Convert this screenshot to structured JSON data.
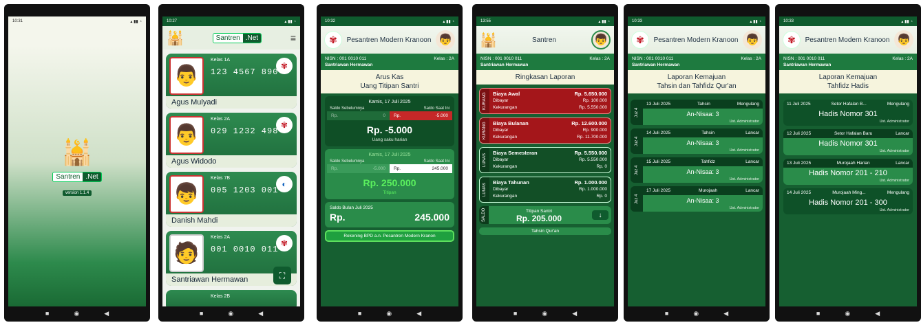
{
  "phone1": {
    "time": "10:31",
    "brand_a": "Santren",
    "brand_b": ".Net",
    "version": "version 1.1.4"
  },
  "phone2": {
    "time": "10:27",
    "brand_a": "Santren",
    "brand_b": ".Net",
    "students": [
      {
        "kelas": "Kelas 1A",
        "num": "123 4567 890",
        "name": "Agus Mulyadi"
      },
      {
        "kelas": "Kelas 2A",
        "num": "029 1232 498",
        "name": "Agus Widodo"
      },
      {
        "kelas": "Kelas 7B",
        "num": "005 1203 001",
        "name": "Danish Mahdi"
      },
      {
        "kelas": "Kelas 2A",
        "num": "001 0010 011",
        "name": "Santriawan Hermawan"
      },
      {
        "kelas": "Kelas 2B",
        "num": "",
        "name": ""
      }
    ]
  },
  "phone3": {
    "time": "10:32",
    "school": "Pesantren Modern Kranoon",
    "nisn": "NISN : 001 0010 011",
    "kelas": "Kelas : 2A",
    "student": "Santriawan Hermawan",
    "title1": "Arus Kas",
    "title2": "Uang Titipan Santri",
    "card1": {
      "date": "Kamis, 17 Juli 2025",
      "prev_label": "Saldo Sebelumnya",
      "now_label": "Saldo Saat Ini",
      "prev_rp": "Rp.",
      "prev_val": "0",
      "now_rp": "Rp.",
      "now_val": "-5.000",
      "amount": "Rp. -5.000",
      "note": "Uang saku harian"
    },
    "card2": {
      "date": "Kamis, 17 Juli 2025",
      "prev_label": "Saldo Sebelumnya",
      "now_label": "Saldo Saat Ini",
      "prev_rp": "Rp.",
      "prev_val": "-5.000",
      "now_rp": "Rp.",
      "now_val": "245.000",
      "amount": "Rp. 250.000",
      "note": "Titipan"
    },
    "bulan_label": "Saldo Bulan Juli 2025",
    "bulan_rp": "Rp.",
    "bulan_val": "245.000",
    "rekening": "Rekening BPD a.n. Pesantren Modern Kranon"
  },
  "phone4": {
    "time": "13:55",
    "app_title": "Santren",
    "nisn": "NISN : 001 0010 011",
    "kelas": "Kelas : 2A",
    "student": "Santriawan Hermawan",
    "title": "Ringkasan Laporan",
    "items": [
      {
        "tag": "KURANG",
        "name": "Biaya Awal",
        "rp": "Rp.",
        "total": "5.650.000",
        "dibayar_rp": "Rp.",
        "dibayar": "100.000",
        "kurang_rp": "Rp.",
        "kurang": "5.550.000",
        "color": "#a4161a"
      },
      {
        "tag": "KURANG",
        "name": "Biaya Bulanan",
        "rp": "Rp.",
        "total": "12.600.000",
        "dibayar_rp": "Rp.",
        "dibayar": "900.000",
        "kurang_rp": "Rp.",
        "kurang": "11.700.000",
        "color": "#a4161a"
      },
      {
        "tag": "LUNAS",
        "name": "Biaya Semesteran",
        "rp": "Rp.",
        "total": "5.550.000",
        "dibayar_rp": "Rp.",
        "dibayar": "5.550.000",
        "kurang_rp": "Rp.",
        "kurang": "0",
        "color": "#124f26"
      },
      {
        "tag": "LUNAS",
        "name": "Biaya Tahunan",
        "rp": "Rp.",
        "total": "1.000.000",
        "dibayar_rp": "Rp.",
        "dibayar": "1.000.000",
        "kurang_rp": "Rp.",
        "kurang": "0",
        "color": "#124f26"
      }
    ],
    "dibayar_label": "Dibayar",
    "kurang_label": "Kekurangan",
    "saldo_tag": "SALDO",
    "saldo_label": "Titipan Santri",
    "saldo_val": "Rp. 205.000",
    "next_label": "Tahsin Qur'an"
  },
  "phone5": {
    "time": "10:33",
    "school": "Pesantren Modern Kranoon",
    "nisn": "NISN : 001 0010 011",
    "kelas": "Kelas : 2A",
    "student": "Santriawan Hermawan",
    "title1": "Laporan Kemajuan",
    "title2": "Tahsin dan Tahfidz Qur'an",
    "items": [
      {
        "juz": "Juz 4",
        "date": "13 Juli 2025",
        "type": "Tahsin",
        "status": "Mengulang",
        "surah": "An-Nisaa: 3",
        "by": "Ust. Administrator"
      },
      {
        "juz": "Juz 4",
        "date": "14 Juli 2025",
        "type": "Tahsin",
        "status": "Lancar",
        "surah": "An-Nisaa: 3",
        "by": "Ust. Administrator"
      },
      {
        "juz": "Juz 4",
        "date": "15 Juli 2025",
        "type": "Tahfidz",
        "status": "Lancar",
        "surah": "An-Nisaa: 3",
        "by": "Ust. Administrator"
      },
      {
        "juz": "Juz 4",
        "date": "17 Juli 2025",
        "type": "Murojaah",
        "status": "Lancar",
        "surah": "An-Nisaa: 3",
        "by": "Ust. Administrator"
      }
    ]
  },
  "phone6": {
    "time": "10:33",
    "school": "Pesantren Modern Kranoon",
    "nisn": "NISN : 001 0010 011",
    "kelas": "Kelas : 2A",
    "student": "Santriawan Hermawan",
    "title1": "Laporan Kemajuan",
    "title2": "Tahfidz Hadis",
    "items": [
      {
        "date": "11 Juli 2025",
        "type": "Setor Hafalan B...",
        "status": "Mengulang",
        "hadis": "Hadis Nomor 301",
        "by": "Ust. Administrator"
      },
      {
        "date": "12 Juli 2025",
        "type": "Setor Hafalan Baru",
        "status": "Lancar",
        "hadis": "Hadis Nomor 301",
        "by": "Ust. Administrator"
      },
      {
        "date": "13 Juli 2025",
        "type": "Murojaah Harian",
        "status": "Lancar",
        "hadis": "Hadis Nomor 201 - 210",
        "by": "Ust. Administrator"
      },
      {
        "date": "14 Juli 2025",
        "type": "Murojaah Ming...",
        "status": "Mengulang",
        "hadis": "Hadis Nomor 201 - 300",
        "by": "Ust. Administrator"
      }
    ]
  },
  "nav": {
    "square": "■",
    "circle": "◉",
    "back": "◀"
  }
}
